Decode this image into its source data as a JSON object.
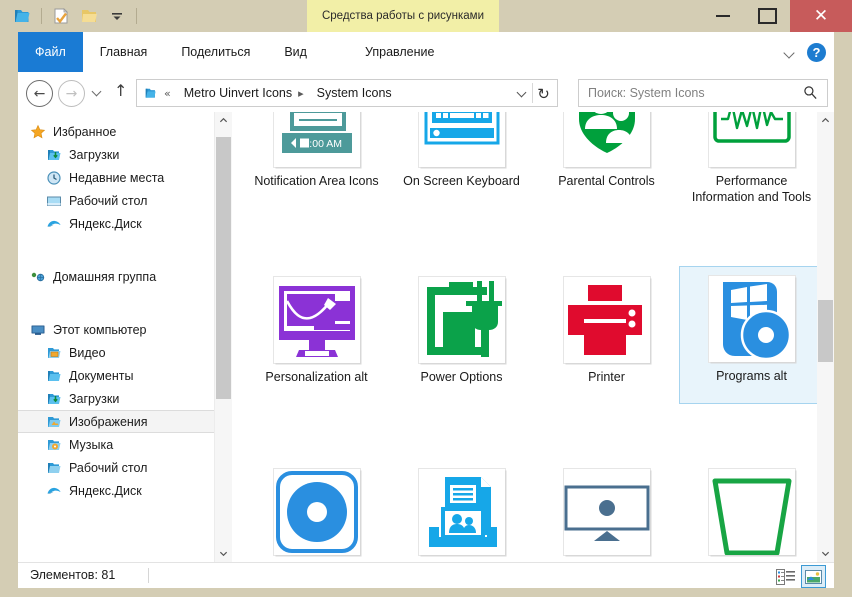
{
  "window": {
    "title": "System Icons",
    "contextual_tab_label": "Средства работы с рисунками",
    "minimize_label": "—",
    "maximize_label": "□",
    "close_label": "✕"
  },
  "quick_access": {
    "items": [
      {
        "name": "folder-blue-icon",
        "label": ""
      },
      {
        "name": "properties-icon",
        "label": ""
      },
      {
        "name": "new-folder-icon",
        "label": ""
      },
      {
        "name": "customize-dropdown-icon",
        "label": "▾"
      }
    ]
  },
  "ribbon": {
    "tabs": [
      {
        "label": "Файл",
        "selected": true,
        "type": "file"
      },
      {
        "label": "Главная",
        "selected": false,
        "type": "normal"
      },
      {
        "label": "Поделиться",
        "selected": false,
        "type": "normal"
      },
      {
        "label": "Вид",
        "selected": false,
        "type": "normal"
      },
      {
        "label": "Управление",
        "selected": false,
        "type": "contextual"
      }
    ],
    "collapse_icon": "chevron-down-icon",
    "help_label": "?"
  },
  "navbar": {
    "back_label": "←",
    "forward_label": "→",
    "recent_dropdown_label": "▾",
    "up_label": "↑",
    "breadcrumb": {
      "prefix": "«",
      "items": [
        "Metro Uinvert Icons",
        "System Icons"
      ],
      "separator": "▸"
    },
    "refresh_label": "↻"
  },
  "search": {
    "placeholder": "Поиск: System Icons",
    "value": "",
    "icon": "search-icon"
  },
  "sidebar": {
    "groups": [
      {
        "header": {
          "label": "Избранное",
          "icon": "star-icon"
        },
        "items": [
          {
            "label": "Загрузки",
            "icon": "downloads-folder-icon"
          },
          {
            "label": "Недавние места",
            "icon": "recent-places-icon"
          },
          {
            "label": "Рабочий стол",
            "icon": "desktop-icon"
          },
          {
            "label": "Яндекс.Диск",
            "icon": "yandex-disk-icon"
          }
        ]
      },
      {
        "header": {
          "label": "Домашняя группа",
          "icon": "homegroup-icon"
        },
        "items": []
      },
      {
        "header": {
          "label": "Этот компьютер",
          "icon": "computer-icon"
        },
        "items": [
          {
            "label": "Видео",
            "icon": "video-folder-icon"
          },
          {
            "label": "Документы",
            "icon": "documents-folder-icon"
          },
          {
            "label": "Загрузки",
            "icon": "downloads-folder-icon"
          },
          {
            "label": "Изображения",
            "icon": "pictures-folder-icon",
            "selected": true
          },
          {
            "label": "Музыка",
            "icon": "music-folder-icon"
          },
          {
            "label": "Рабочий стол",
            "icon": "desktop-folder-icon"
          },
          {
            "label": "Яндекс.Диск",
            "icon": "yandex-disk-icon"
          }
        ]
      }
    ],
    "scroll_up_label": "⌃",
    "scroll_down_label": "⌄"
  },
  "content": {
    "items": [
      {
        "caption": "Notification Area Icons",
        "icon": "notification-area-icons-thumbnail",
        "selected": false
      },
      {
        "caption": "On Screen Keyboard",
        "icon": "on-screen-keyboard-thumbnail",
        "selected": false
      },
      {
        "caption": "Parental Controls",
        "icon": "parental-controls-thumbnail",
        "selected": false
      },
      {
        "caption": "Performance Information and Tools",
        "icon": "performance-information-thumbnail",
        "selected": false
      },
      {
        "caption": "Personalization alt",
        "icon": "personalization-alt-thumbnail",
        "selected": false
      },
      {
        "caption": "Power Options",
        "icon": "power-options-thumbnail",
        "selected": false
      },
      {
        "caption": "Printer",
        "icon": "printer-thumbnail",
        "selected": false
      },
      {
        "caption": "Programs alt",
        "icon": "programs-alt-thumbnail",
        "selected": true
      },
      {
        "caption": "",
        "icon": "disc-blue-thumbnail",
        "selected": false
      },
      {
        "caption": "",
        "icon": "public-folder-thumbnail",
        "selected": false
      },
      {
        "caption": "",
        "icon": "remote-desktop-thumbnail",
        "selected": false
      },
      {
        "caption": "",
        "icon": "recycle-bin-empty-thumbnail",
        "selected": false
      }
    ],
    "notification_clock": "0:00 AM",
    "scroll_up_label": "⌃",
    "scroll_down_label": "⌄"
  },
  "statusbar": {
    "items_count_label": "Элементов: 81",
    "view_details_icon": "details-view-icon",
    "view_large_icons_icon": "large-icons-view-icon"
  },
  "colors": {
    "window_chrome": "#d4cdb4",
    "file_tab_blue": "#1a7bd4",
    "contextual_tab_yellow": "#f2efa7",
    "close_button_red": "#c75b5b",
    "selection_blue": "#e8f4fb",
    "selection_border": "#a6d4ef"
  }
}
